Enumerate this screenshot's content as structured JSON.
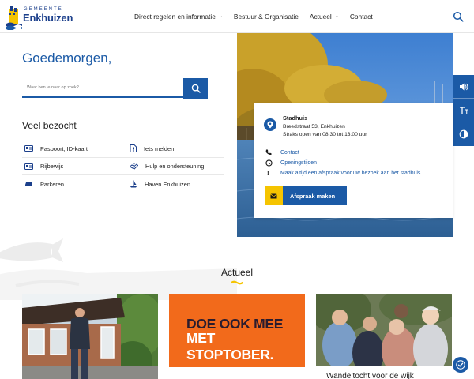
{
  "header": {
    "logo_small": "GEMEENTE",
    "logo_big": "Enkhuizen",
    "nav": [
      {
        "label": "Direct regelen en informatie",
        "dropdown": true
      },
      {
        "label": "Bestuur & Organisatie",
        "dropdown": false
      },
      {
        "label": "Actueel",
        "dropdown": true
      },
      {
        "label": "Contact",
        "dropdown": false
      }
    ]
  },
  "greeting": "Goedemorgen,",
  "search": {
    "placeholder": "Waar ben je naar op zoek?"
  },
  "popular": {
    "title": "Veel bezocht",
    "rows": [
      [
        {
          "label": "Paspoort, ID-kaart",
          "icon": "id-card-icon"
        },
        {
          "label": "Iets melden",
          "icon": "report-icon"
        }
      ],
      [
        {
          "label": "Rijbewijs",
          "icon": "drivers-license-icon"
        },
        {
          "label": "Hulp en ondersteuning",
          "icon": "support-icon"
        }
      ],
      [
        {
          "label": "Parkeren",
          "icon": "car-icon"
        },
        {
          "label": "Haven Enkhuizen",
          "icon": "harbor-icon"
        }
      ]
    ]
  },
  "stadhuis": {
    "title": "Stadhuis",
    "address": "Breedstraat 53, Enkhuizen",
    "hours": "Straks open van 08:30 tot 13:00 uur",
    "links": [
      {
        "label": "Contact",
        "icon": "phone-icon"
      },
      {
        "label": "Openingstijden",
        "icon": "clock-icon"
      },
      {
        "label": "Maak altijd een afspraak voor uw bezoek aan het stadhuis",
        "icon": "exclamation-icon"
      }
    ],
    "button": "Afspraak maken"
  },
  "tools": [
    "speaker-icon",
    "text-size-icon",
    "contrast-icon"
  ],
  "news": {
    "title": "Actueel",
    "items": [
      {
        "image": "man-in-front-of-building-photo"
      },
      {
        "headline_line1": "DOE OOK MEE",
        "headline_line2": "MET STOPTOBER."
      },
      {
        "image": "group-of-elderly-people-photo",
        "caption": "Wandeltocht voor de wijk"
      }
    ]
  },
  "colors": {
    "brand_blue": "#1b5aa6",
    "accent_yellow": "#f5c400",
    "stoptober_orange": "#f26a1b"
  }
}
